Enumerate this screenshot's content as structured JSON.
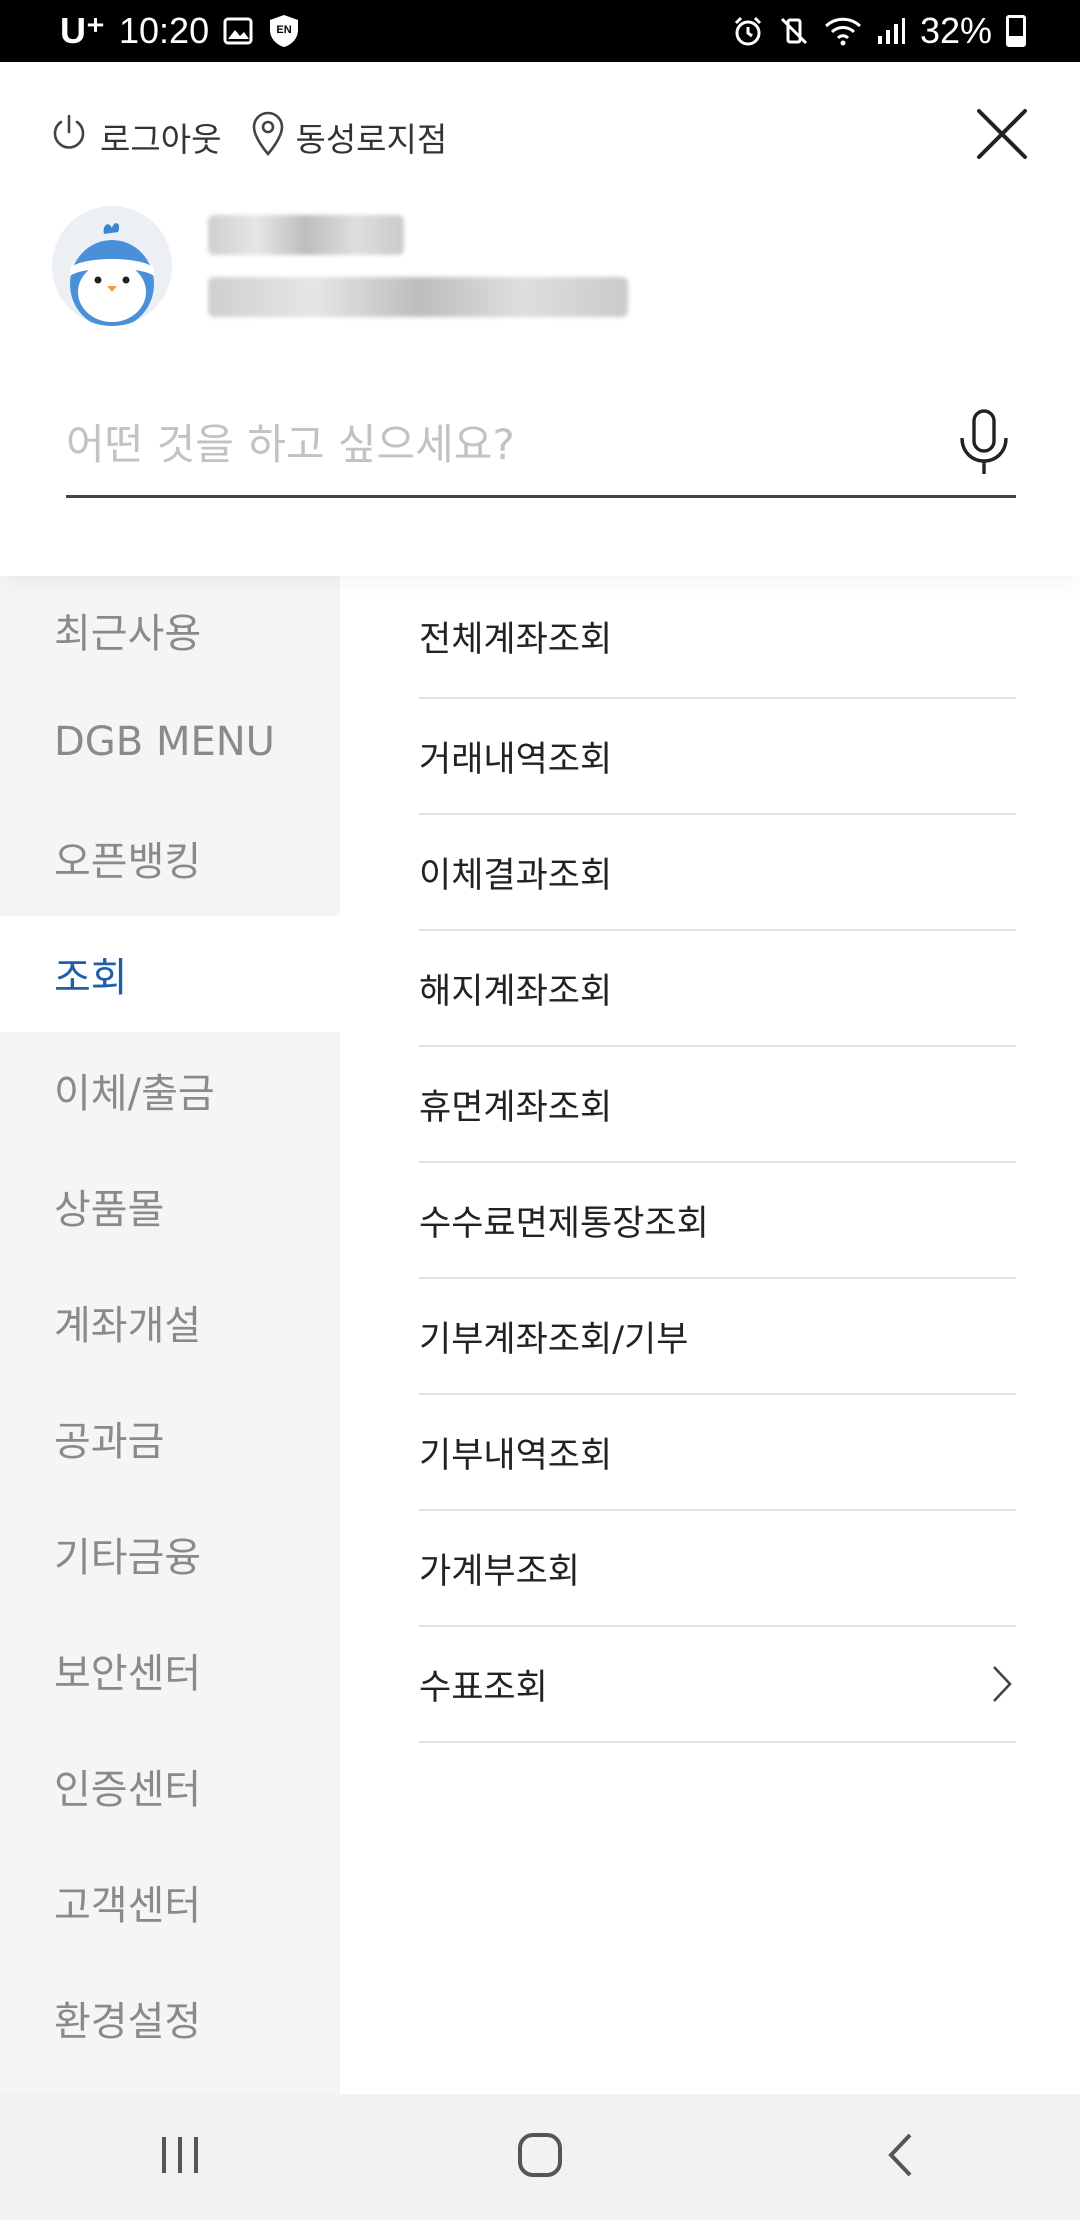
{
  "status_bar": {
    "carrier": "U⁺",
    "time": "10:20",
    "battery": "32%",
    "icons": [
      "image-icon",
      "shield-en-icon",
      "alarm-icon",
      "vibrate-mute-icon",
      "wifi-icon",
      "signal-icon",
      "battery-icon"
    ]
  },
  "header": {
    "logout_label": "로그아웃",
    "branch_label": "동성로지점",
    "search_placeholder": "어떤 것을 하고 싶으세요?"
  },
  "sidebar": {
    "items": [
      {
        "label": "최근사용",
        "active": false
      },
      {
        "label": "DGB MENU",
        "active": false
      },
      {
        "label": "오픈뱅킹",
        "active": false
      },
      {
        "label": "조회",
        "active": true
      },
      {
        "label": "이체/출금",
        "active": false
      },
      {
        "label": "상품몰",
        "active": false
      },
      {
        "label": "계좌개설",
        "active": false
      },
      {
        "label": "공과금",
        "active": false
      },
      {
        "label": "기타금융",
        "active": false
      },
      {
        "label": "보안센터",
        "active": false
      },
      {
        "label": "인증센터",
        "active": false
      },
      {
        "label": "고객센터",
        "active": false
      },
      {
        "label": "환경설정",
        "active": false
      }
    ]
  },
  "submenu": {
    "items": [
      {
        "label": "전체계좌조회"
      },
      {
        "label": "거래내역조회"
      },
      {
        "label": "이체결과조회"
      },
      {
        "label": "해지계좌조회"
      },
      {
        "label": "휴면계좌조회"
      },
      {
        "label": "수수료면제통장조회"
      },
      {
        "label": "기부계좌조회/기부"
      },
      {
        "label": "기부내역조회"
      },
      {
        "label": "가계부조회"
      },
      {
        "label": "수표조회",
        "has_submenu": true
      }
    ]
  },
  "colors": {
    "accent": "#1f5fa8",
    "sidebar_bg": "#f5f5f5",
    "inactive_text": "#8a8a8a"
  }
}
